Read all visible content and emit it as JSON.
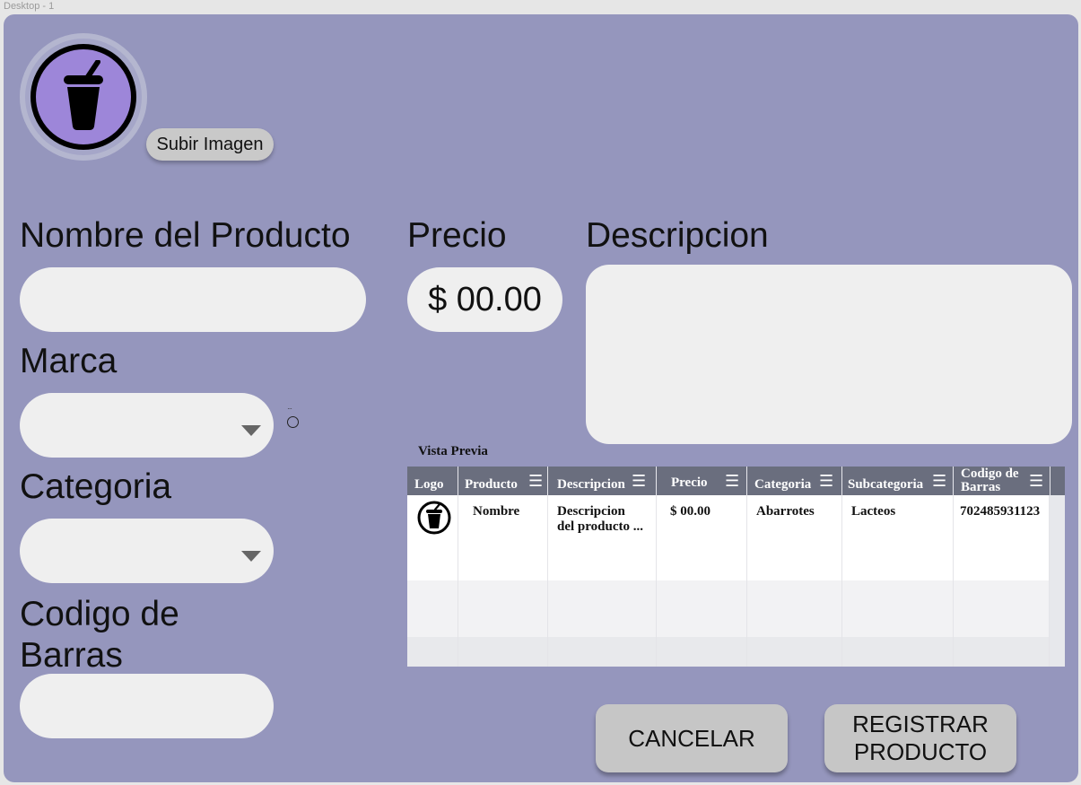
{
  "frame_label": "Desktop - 1",
  "logo": {
    "icon": "drink-cup-icon",
    "colors": {
      "circle": "#9d86d9",
      "ring": "#a5a6c8"
    }
  },
  "upload_button": "Subir Imagen",
  "form": {
    "nombre_label": "Nombre del Producto",
    "nombre_value": "",
    "marca_label": "Marca",
    "marca_value": "",
    "categoria_label": "Categoria",
    "categoria_value": "",
    "codigo_label_line1": "Codigo de",
    "codigo_label_line2": "Barras",
    "codigo_value": "",
    "precio_label": "Precio",
    "precio_value": "$ 00.00",
    "descripcion_label": "Descripcion",
    "descripcion_value": ""
  },
  "preview": {
    "title": "Vista Previa",
    "headers": {
      "logo": "Logo",
      "producto": "Producto",
      "descripcion": "Descripcion",
      "precio": "Precio",
      "categoria": "Categoria",
      "subcategoria": "Subcategoria",
      "codigo_line1": "Codigo de",
      "codigo_line2": "Barras"
    },
    "row": {
      "producto": "Nombre",
      "descripcion_line1": "Descripcion",
      "descripcion_line2": "del producto ...",
      "precio": "$ 00.00",
      "categoria": "Abarrotes",
      "subcategoria": "Lacteos",
      "codigo": "702485931123"
    }
  },
  "buttons": {
    "cancel": "CANCELAR",
    "register_line1": "REGISTRAR",
    "register_line2": "PRODUCTO"
  },
  "colors": {
    "panel": "#9596bd",
    "field": "#efefef",
    "table_header": "#6a6e7e",
    "button": "#c6c6c6"
  }
}
